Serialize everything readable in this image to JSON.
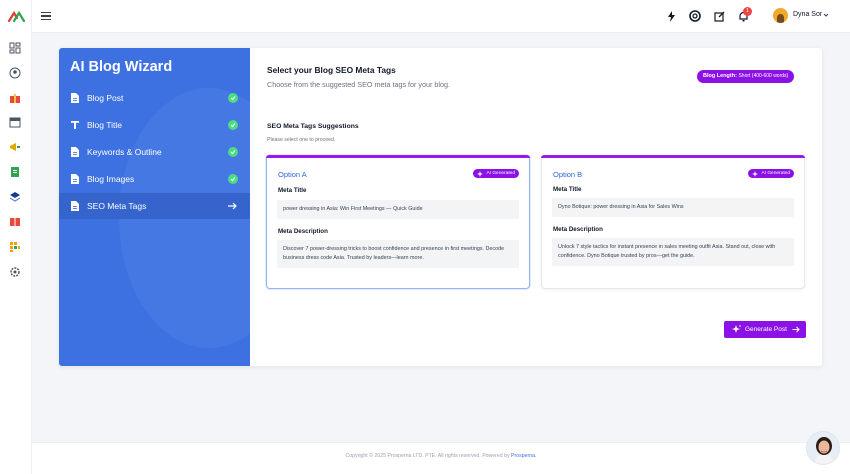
{
  "topbar": {
    "notifications_count": "1",
    "user_name": "Dyna Sor",
    "icons": [
      "bolt-icon",
      "openai-icon",
      "external-edit-icon",
      "bell-icon"
    ]
  },
  "rail": {
    "icons": [
      "dashboard-icon",
      "user-circle-icon",
      "gift-icon",
      "calendar-icon",
      "megaphone-icon",
      "document-icon",
      "layers-icon",
      "book-icon",
      "grid-icon",
      "settings-icon"
    ]
  },
  "wizard": {
    "title": "AI Blog Wizard",
    "steps": [
      {
        "label": "Blog Post",
        "status": "done",
        "icon": "document-icon"
      },
      {
        "label": "Blog Title",
        "status": "done",
        "icon": "text-icon"
      },
      {
        "label": "Keywords & Outline",
        "status": "done",
        "icon": "document-icon"
      },
      {
        "label": "Blog Images",
        "status": "done",
        "icon": "document-icon"
      },
      {
        "label": "SEO Meta Tags",
        "status": "active",
        "icon": "document-icon"
      }
    ]
  },
  "main": {
    "heading": "Select your Blog SEO Meta Tags",
    "subheading": "Choose from the suggested SEO meta tags for your blog.",
    "length_prefix": "Blog Length:",
    "length_value": "Short (400-600 words)",
    "suggestions_title": "SEO Meta Tags Suggestions",
    "suggestions_hint": "Please select one to proceed.",
    "options": [
      {
        "label": "Option A",
        "badge": "AI Generated",
        "meta_title_label": "Meta Title",
        "meta_title": "power dressing in Asia: Win First Meetings — Quick Guide",
        "meta_desc_label": "Meta Description",
        "meta_desc": "Discover 7 power-dressing tricks to boost confidence and presence in first meetings. Decode business dress code Asia. Trusted by leaders—learn more.",
        "selected": true
      },
      {
        "label": "Option B",
        "badge": "AI Generated",
        "meta_title_label": "Meta Title",
        "meta_title": "Dyno Botique: power dressing in Asia for Sales Wins",
        "meta_desc_label": "Meta Description",
        "meta_desc": "Unlock 7 style tactics for instant presence in sales meeting outfit Asia. Stand out, close with confidence. Dyno Botique trusted by pros—get the guide.",
        "selected": false
      }
    ],
    "generate_label": "Generate Post"
  },
  "footer": {
    "text": "Copyright © 2025 Prosperna LTD. PTE. All rights reserved. Powered by",
    "link": "Prosperna."
  },
  "colors": {
    "wizard_bg": "#3d71e2",
    "accent_purple": "#8b12e6",
    "check_green": "#4ade80",
    "option_blue": "#2f63d6"
  }
}
